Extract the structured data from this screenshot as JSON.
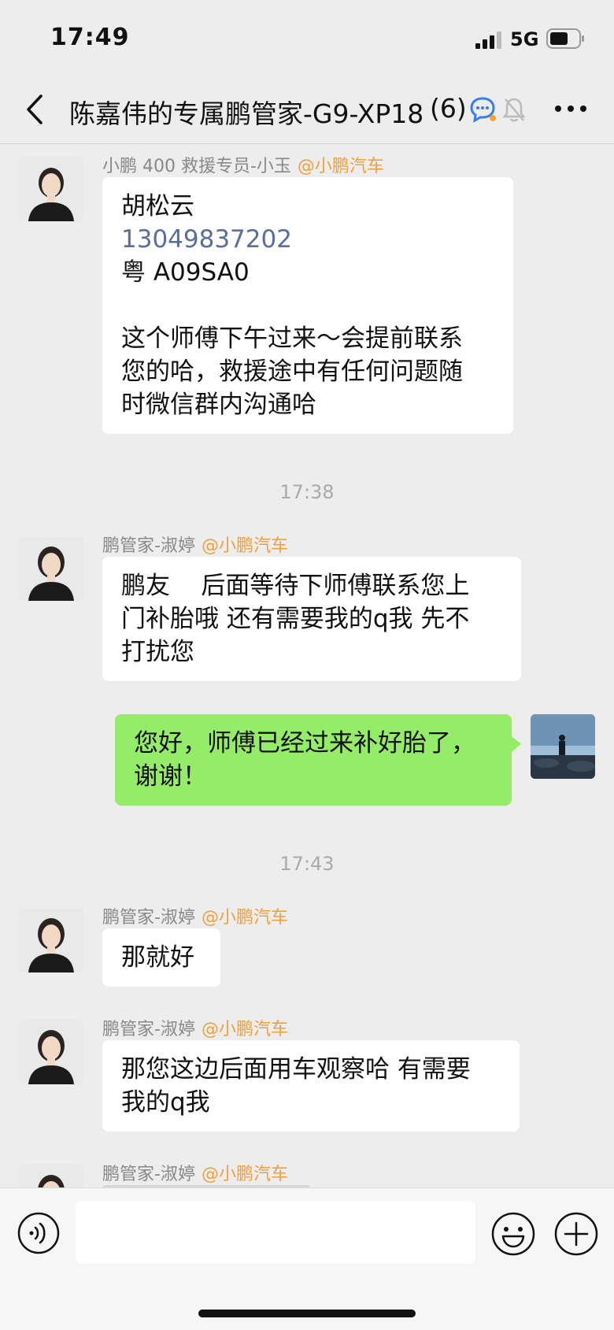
{
  "status": {
    "time": "17:49",
    "network": "5G"
  },
  "header": {
    "title": "陈嘉伟的专属鹏管家-G9-XP18",
    "count": "(6)"
  },
  "messages": [
    {
      "sender": "小鹏 400 救援专员-小玉",
      "tag": "@小鹏汽车",
      "lines": [
        "胡松云",
        "13049837202",
        "粤 A09SA0",
        "",
        "这个师傅下午过来～会提前联系",
        "您的哈，救援途中有任何问题随",
        "时微信群内沟通哈"
      ]
    },
    {
      "timestamp": "17:38"
    },
    {
      "sender": "鹏管家-淑婷",
      "tag": "@小鹏汽车",
      "lines": [
        "鹏友    后面等待下师傅联系您上",
        "门补胎哦 还有需要我的q我 先不",
        "打扰您"
      ]
    },
    {
      "self": true,
      "lines": [
        "您好，师傅已经过来补好胎了，",
        "谢谢！"
      ]
    },
    {
      "timestamp": "17:43"
    },
    {
      "sender": "鹏管家-淑婷",
      "tag": "@小鹏汽车",
      "lines": [
        "那就好"
      ]
    },
    {
      "sender": "鹏管家-淑婷",
      "tag": "@小鹏汽车",
      "lines": [
        "那您这边后面用车观察哈 有需要",
        "我的q我"
      ]
    },
    {
      "sender": "鹏管家-淑婷",
      "tag": "@小鹏汽车"
    }
  ],
  "input": {
    "value": ""
  },
  "icons": {
    "back": "chevron-left-icon",
    "chat": "chat-bubble-icon",
    "mute": "muted-bell-icon",
    "more": "more-dots-icon",
    "voice": "voice-icon",
    "emoji": "emoji-icon",
    "plus": "plus-icon"
  }
}
